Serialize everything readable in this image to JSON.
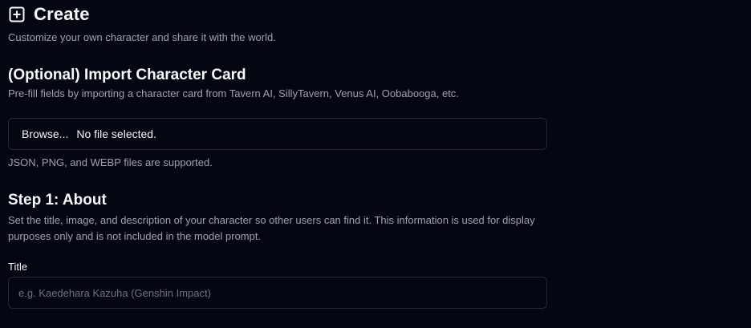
{
  "header": {
    "icon": "plus-square-icon",
    "title": "Create",
    "subtitle": "Customize your own character and share it with the world."
  },
  "import": {
    "heading": "(Optional) Import Character Card",
    "description": "Pre-fill fields by importing a character card from Tavern AI, SillyTavern, Venus AI, Oobabooga, etc.",
    "browse_label": "Browse...",
    "file_status": "No file selected.",
    "hint": "JSON, PNG, and WEBP files are supported."
  },
  "step1": {
    "heading": "Step 1: About",
    "description": "Set the title, image, and description of your character so other users can find it. This information is used for display purposes only and is not included in the model prompt.",
    "title_label": "Title",
    "title_placeholder": "e.g. Kaedehara Kazuha (Genshin Impact)",
    "title_value": ""
  }
}
